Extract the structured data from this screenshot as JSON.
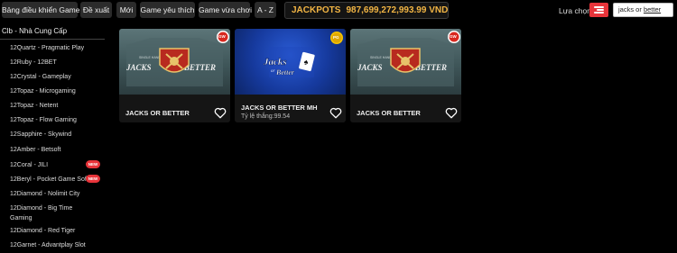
{
  "topbar": {
    "tabs": [
      {
        "label": "Bảng điều khiển Game"
      },
      {
        "label": "Đề xuất"
      },
      {
        "label": "Mới"
      },
      {
        "label": "Game yêu thích"
      },
      {
        "label": "Game vừa chơi"
      },
      {
        "label": "A - Z"
      }
    ],
    "jackpot_label": "JACKPOTS",
    "jackpot_value": "987,699,272,993.99 VND",
    "choose_label": "Lựa chọn",
    "choose_icon": "filter-icon",
    "search": {
      "value_prefix": "jacks or ",
      "value_underlined": "better"
    }
  },
  "sidebar": {
    "heading": "Clb - Nhà Cung Cấp",
    "items": [
      {
        "label": "12Quartz - Pragmatic Play"
      },
      {
        "label": "12Ruby - 12BET"
      },
      {
        "label": "12Crystal - Gameplay"
      },
      {
        "label": "12Topaz - Microgaming"
      },
      {
        "label": "12Topaz - Netent"
      },
      {
        "label": "12Topaz - Flow Gaming"
      },
      {
        "label": "12Sapphire - Skywind"
      },
      {
        "label": "12Amber - Betsoft"
      },
      {
        "label": "12Coral - JILI",
        "badge": "NEW"
      },
      {
        "label": "12Beryl - Pocket Game Soft",
        "badge": "NEW"
      },
      {
        "label": "12Diamond - Nolimit City"
      },
      {
        "label": "12Diamond - Big Time Gaming"
      },
      {
        "label": "12Diamond - Red Tiger"
      },
      {
        "label": "12Garnet - Advantplay Slot"
      }
    ]
  },
  "games": [
    {
      "title": "JACKS OR BETTER",
      "art_text": "JACKS OR BETTER",
      "art_small": "SINGLE HAND",
      "corner": "GW",
      "favorite_icon": "heart-icon"
    },
    {
      "title": "JACKS OR BETTER MH",
      "subtitle": "Tỷ lệ thắng:99.54",
      "art_text": "Jacks or Better",
      "corner": "PG",
      "favorite_icon": "heart-icon"
    },
    {
      "title": "JACKS OR BETTER",
      "art_text": "JACKS OR BETTER",
      "art_small": "SINGLE HAND",
      "corner": "GW",
      "favorite_icon": "heart-icon"
    }
  ],
  "colors": {
    "accent": "#e8343a",
    "jackpot": "#f2b544",
    "background": "#000000",
    "tab_bg": "#2b2b2b"
  }
}
